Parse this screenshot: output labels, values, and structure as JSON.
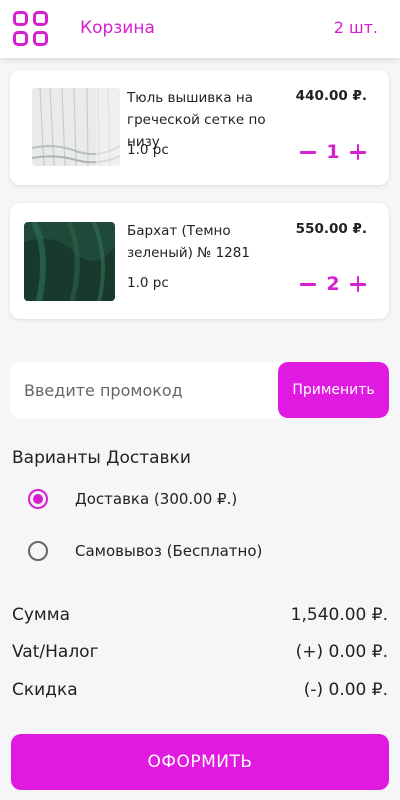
{
  "header": {
    "title": "Корзина",
    "count": "2 шт."
  },
  "cart": {
    "items": [
      {
        "name": "Тюль вышивка на греческой сетке по низу",
        "price": "440.00 ₽.",
        "unit": "1.0 pc",
        "qty": "1"
      },
      {
        "name": "Бархат (Темно зеленый) № 1281",
        "price": "550.00 ₽.",
        "unit": "1.0 pc",
        "qty": "2"
      }
    ]
  },
  "promo": {
    "placeholder": "Введите промокод",
    "apply_label": "Применить"
  },
  "delivery": {
    "title": "Варианты Доставки",
    "options": [
      {
        "label": "Доставка (300.00 ₽.)",
        "selected": true
      },
      {
        "label": "Самовывоз (Бесплатно)",
        "selected": false
      }
    ]
  },
  "summary": {
    "rows": [
      {
        "label": "Сумма",
        "value": "1,540.00 ₽."
      },
      {
        "label": "Vat/Налог",
        "value": "(+) 0.00 ₽."
      },
      {
        "label": "Скидка",
        "value": "(-) 0.00 ₽."
      }
    ]
  },
  "checkout_label": "ОФОРМИТЬ",
  "colors": {
    "accent": "#d61fd0",
    "button": "#e01ae0",
    "background": "#f6f6f8"
  }
}
